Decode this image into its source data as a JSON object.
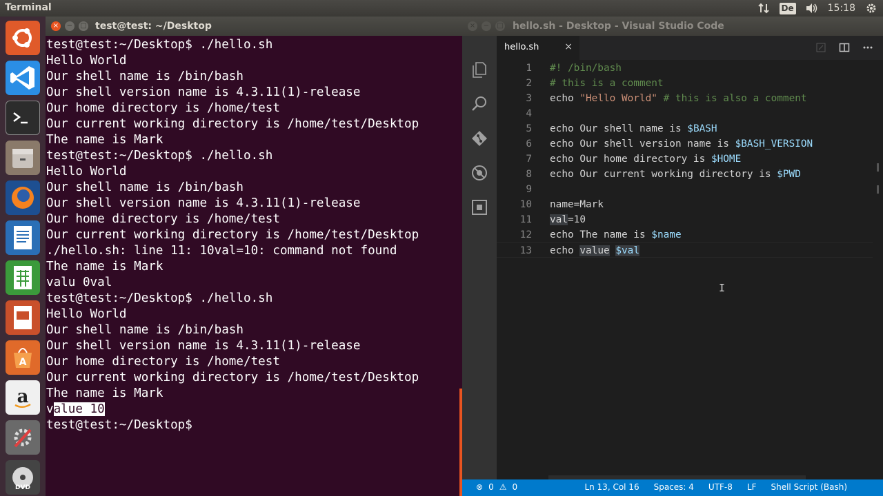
{
  "top_panel": {
    "app_name": "Terminal",
    "keyboard_layout": "De",
    "clock": "15:18"
  },
  "launcher": {
    "items": [
      "ubuntu-dash",
      "visual-studio-code",
      "terminal",
      "files",
      "firefox",
      "libreoffice-writer",
      "libreoffice-calc",
      "libreoffice-impress",
      "ubuntu-software",
      "amazon",
      "system-settings",
      "dvd"
    ]
  },
  "terminal": {
    "title": "test@test: ~/Desktop",
    "lines": [
      "test@test:~/Desktop$ ./hello.sh",
      "Hello World",
      "Our shell name is /bin/bash",
      "Our shell version name is 4.3.11(1)-release",
      "Our home directory is /home/test",
      "Our current working directory is /home/test/Desktop",
      "The name is Mark",
      "test@test:~/Desktop$ ./hello.sh",
      "Hello World",
      "Our shell name is /bin/bash",
      "Our shell version name is 4.3.11(1)-release",
      "Our home directory is /home/test",
      "Our current working directory is /home/test/Desktop",
      "./hello.sh: line 11: 10val=10: command not found",
      "The name is Mark",
      "valu 0val",
      "test@test:~/Desktop$ ./hello.sh",
      "Hello World",
      "Our shell name is /bin/bash",
      "Our shell version name is 4.3.11(1)-release",
      "Our home directory is /home/test",
      "Our current working directory is /home/test/Desktop",
      "The name is Mark"
    ],
    "selected_first_char": "v",
    "selected_rest": "alue 10",
    "prompt": "test@test:~/Desktop$ "
  },
  "vscode": {
    "title": "hello.sh - Desktop - Visual Studio Code",
    "tab_label": "hello.sh",
    "tab_close": "×",
    "code_lines": [
      {
        "n": "1",
        "parts": [
          [
            "c-comment",
            "#! /bin/bash"
          ]
        ]
      },
      {
        "n": "2",
        "parts": [
          [
            "c-comment",
            "# this is a comment"
          ]
        ]
      },
      {
        "n": "3",
        "parts": [
          [
            "",
            "echo "
          ],
          [
            "c-string",
            "\"Hello World\""
          ],
          [
            "",
            " "
          ],
          [
            "c-comment",
            "# this is also a comment"
          ]
        ]
      },
      {
        "n": "4",
        "parts": []
      },
      {
        "n": "5",
        "parts": [
          [
            "",
            "echo Our shell name is "
          ],
          [
            "c-var",
            "$BASH"
          ]
        ]
      },
      {
        "n": "6",
        "parts": [
          [
            "",
            "echo Our shell version name is "
          ],
          [
            "c-var",
            "$BASH_VERSION"
          ]
        ]
      },
      {
        "n": "7",
        "parts": [
          [
            "",
            "echo Our home directory is "
          ],
          [
            "c-var",
            "$HOME"
          ]
        ]
      },
      {
        "n": "8",
        "parts": [
          [
            "",
            "echo Our current working directory is "
          ],
          [
            "c-var",
            "$PWD"
          ]
        ]
      },
      {
        "n": "9",
        "parts": []
      },
      {
        "n": "10",
        "parts": [
          [
            "",
            "name=Mark"
          ]
        ]
      },
      {
        "n": "11",
        "parts": [
          [
            "c-hl",
            "val"
          ],
          [
            "",
            "=10"
          ]
        ]
      },
      {
        "n": "12",
        "parts": [
          [
            "",
            "echo The name is "
          ],
          [
            "c-var",
            "$name"
          ]
        ]
      },
      {
        "n": "13",
        "parts": [
          [
            "",
            "echo "
          ],
          [
            "c-hl",
            "value"
          ],
          [
            "",
            " "
          ],
          [
            "c-var c-hl",
            "$val"
          ]
        ]
      }
    ],
    "status": {
      "errors": "0",
      "warnings": "0",
      "position": "Ln 13, Col 16",
      "spaces": "Spaces: 4",
      "encoding": "UTF-8",
      "eol": "LF",
      "language": "Shell Script (Bash)"
    }
  }
}
